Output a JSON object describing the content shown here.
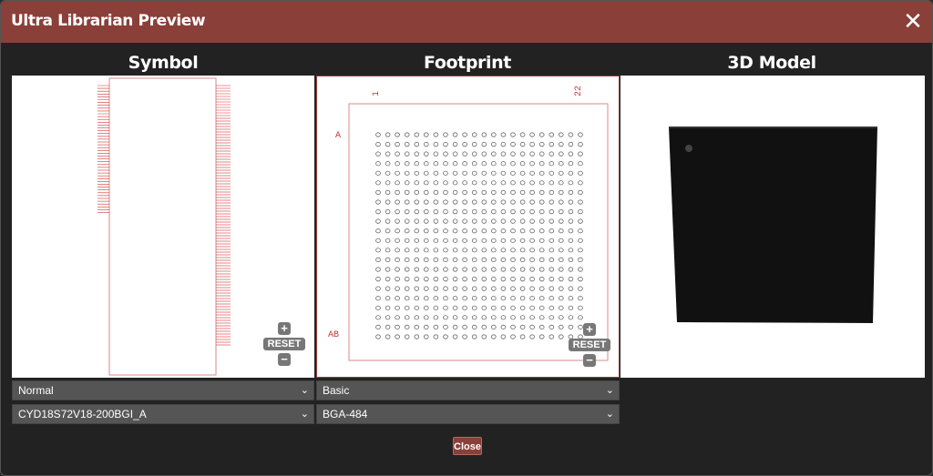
{
  "window": {
    "title": "Ultra Librarian Preview"
  },
  "panels": {
    "symbol": {
      "title": "Symbol"
    },
    "footprint": {
      "title": "Footprint",
      "col_first": "1",
      "col_last": "22",
      "row_first": "A",
      "row_last": "AB"
    },
    "model3d": {
      "title": "3D Model"
    }
  },
  "zoom": {
    "plus": "+",
    "reset": "RESET",
    "minus": "−"
  },
  "selects": {
    "symbol_view": "Normal",
    "symbol_part": "CYD18S72V18-200BGI_A",
    "footprint_view": "Basic",
    "footprint_package": "BGA-484"
  },
  "footer": {
    "close_label": "Close"
  },
  "icons": {
    "close": "close-icon",
    "chevron": "chevron-down-icon"
  },
  "colors": {
    "titlebar": "#8b3f39",
    "panel_border": "#9b3a3a",
    "select_bg": "#555555"
  }
}
